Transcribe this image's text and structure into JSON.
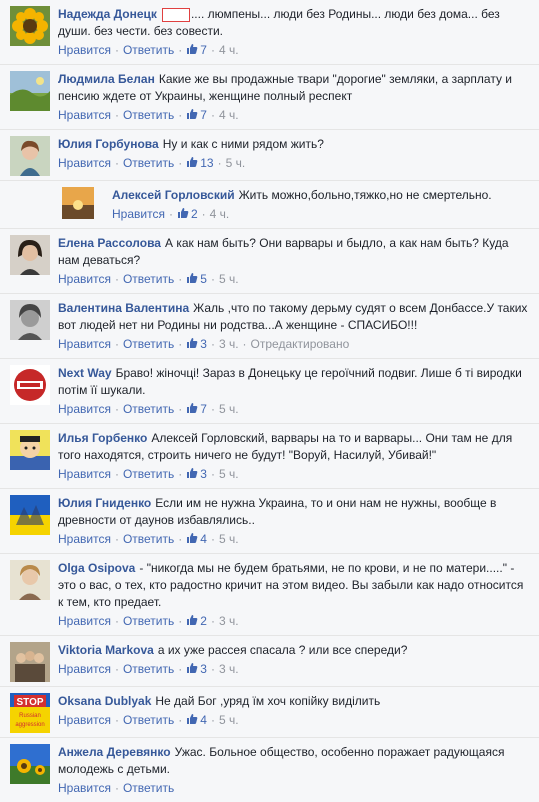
{
  "comments": [
    {
      "author": "Надежда Донецк",
      "text_before": "",
      "text": ".... люмпены... люди без Родины... люди без дома... без души. без чести. без совести.",
      "has_redbox": true,
      "like_label": "Нравится",
      "reply_label": "Ответить",
      "likes": "7",
      "time": "4 ч.",
      "edited": "",
      "avatar": "sunflower-avatar"
    },
    {
      "author": "Людмила Белан",
      "text": "Какие же вы продажные твари \"дорогие\" земляки, а зарплату и пенсию ждете от Украины, женщине полный респект",
      "like_label": "Нравится",
      "reply_label": "Ответить",
      "likes": "7",
      "time": "4 ч.",
      "edited": "",
      "avatar": "landscape-avatar"
    },
    {
      "author": "Юлия Горбунова",
      "text": "Ну и как с ними рядом жить?",
      "like_label": "Нравится",
      "reply_label": "Ответить",
      "likes": "13",
      "time": "5 ч.",
      "edited": "",
      "avatar": "woman-avatar"
    },
    {
      "author": "Алексей Горловский",
      "text": "Жить можно,больно,тяжко,но не смертельно.",
      "like_label": "Нравится",
      "reply_label": "",
      "likes": "2",
      "time": "4 ч.",
      "edited": "",
      "avatar": "sunset-avatar",
      "is_reply": true
    },
    {
      "author": "Елена Рассолова",
      "text": "А как нам быть? Они варвары и быдло, а как нам быть? Куда нам деваться?",
      "like_label": "Нравится",
      "reply_label": "Ответить",
      "likes": "5",
      "time": "5 ч.",
      "edited": "",
      "avatar": "dark-hair-avatar"
    },
    {
      "author": "Валентина Валентина",
      "text": "Жаль ,что по такому дерьму судят о всем Донбассе.У таких вот людей нет ни Родины ни родства...А женщине - СПАСИБО!!!",
      "like_label": "Нравится",
      "reply_label": "Ответить",
      "likes": "3",
      "time": "3 ч.",
      "edited": "Отредактировано",
      "avatar": "bw-woman-avatar"
    },
    {
      "author": "Next Way",
      "text": "Браво! жiночці! Зараз в Донецьку це героїчний подвиг. Лише б ті виродки потім її шукали.",
      "like_label": "Нравится",
      "reply_label": "Ответить",
      "likes": "7",
      "time": "5 ч.",
      "edited": "",
      "avatar": "nextway-logo-avatar"
    },
    {
      "author": "Илья Горбенко",
      "text": "Алексей Горловский, варвары на то и варвары... Они там не для того находятся, строить ничего не будут! \"Воруй, Насилуй, Убивай!\"",
      "like_label": "Нравится",
      "reply_label": "Ответить",
      "likes": "3",
      "time": "5 ч.",
      "edited": "",
      "avatar": "cartoon-avatar"
    },
    {
      "author": "Юлия Гниденко",
      "text": "Если им не нужна Украина, то и они нам не нужны, вообще в древности от даунов избавлялись..",
      "like_label": "Нравится",
      "reply_label": "Ответить",
      "likes": "4",
      "time": "5 ч.",
      "edited": "",
      "avatar": "flag-avatar"
    },
    {
      "author": "Olga Osipova",
      "text": "- \"никогда мы не будем братьями, не по крови, и не по матери.....\" - это о вас, о тех, кто радостно кричит на этом видео. Вы забыли как надо относится к тем, кто предает.",
      "like_label": "Нравится",
      "reply_label": "Ответить",
      "likes": "2",
      "time": "3 ч.",
      "edited": "",
      "avatar": "olga-avatar"
    },
    {
      "author": "Viktoria Markova",
      "text": "а их уже рассея спасала ? или все спереди?",
      "like_label": "Нравится",
      "reply_label": "Ответить",
      "likes": "3",
      "time": "3 ч.",
      "edited": "",
      "avatar": "group-avatar"
    },
    {
      "author": "Oksana Dublyak",
      "text": "Не дай Бог ,уряд їм хоч копійку виділить",
      "like_label": "Нравится",
      "reply_label": "Ответить",
      "likes": "4",
      "time": "5 ч.",
      "edited": "",
      "avatar": "stop-aggression-avatar",
      "avatar_text": [
        "STOP",
        "Russian",
        "aggression"
      ]
    },
    {
      "author": "Анжела Деревянко",
      "text": "Ужас. Больное общество, особенно поражает радующаяся молодежь с детьми.",
      "like_label": "Нравится",
      "reply_label": "Ответить",
      "likes": "",
      "time": "",
      "edited": "",
      "avatar": "sunflower-field-avatar"
    }
  ],
  "colors": {
    "author": "#365899",
    "link": "#4267b2",
    "meta": "#90949c",
    "background": "#f6f7f9"
  }
}
